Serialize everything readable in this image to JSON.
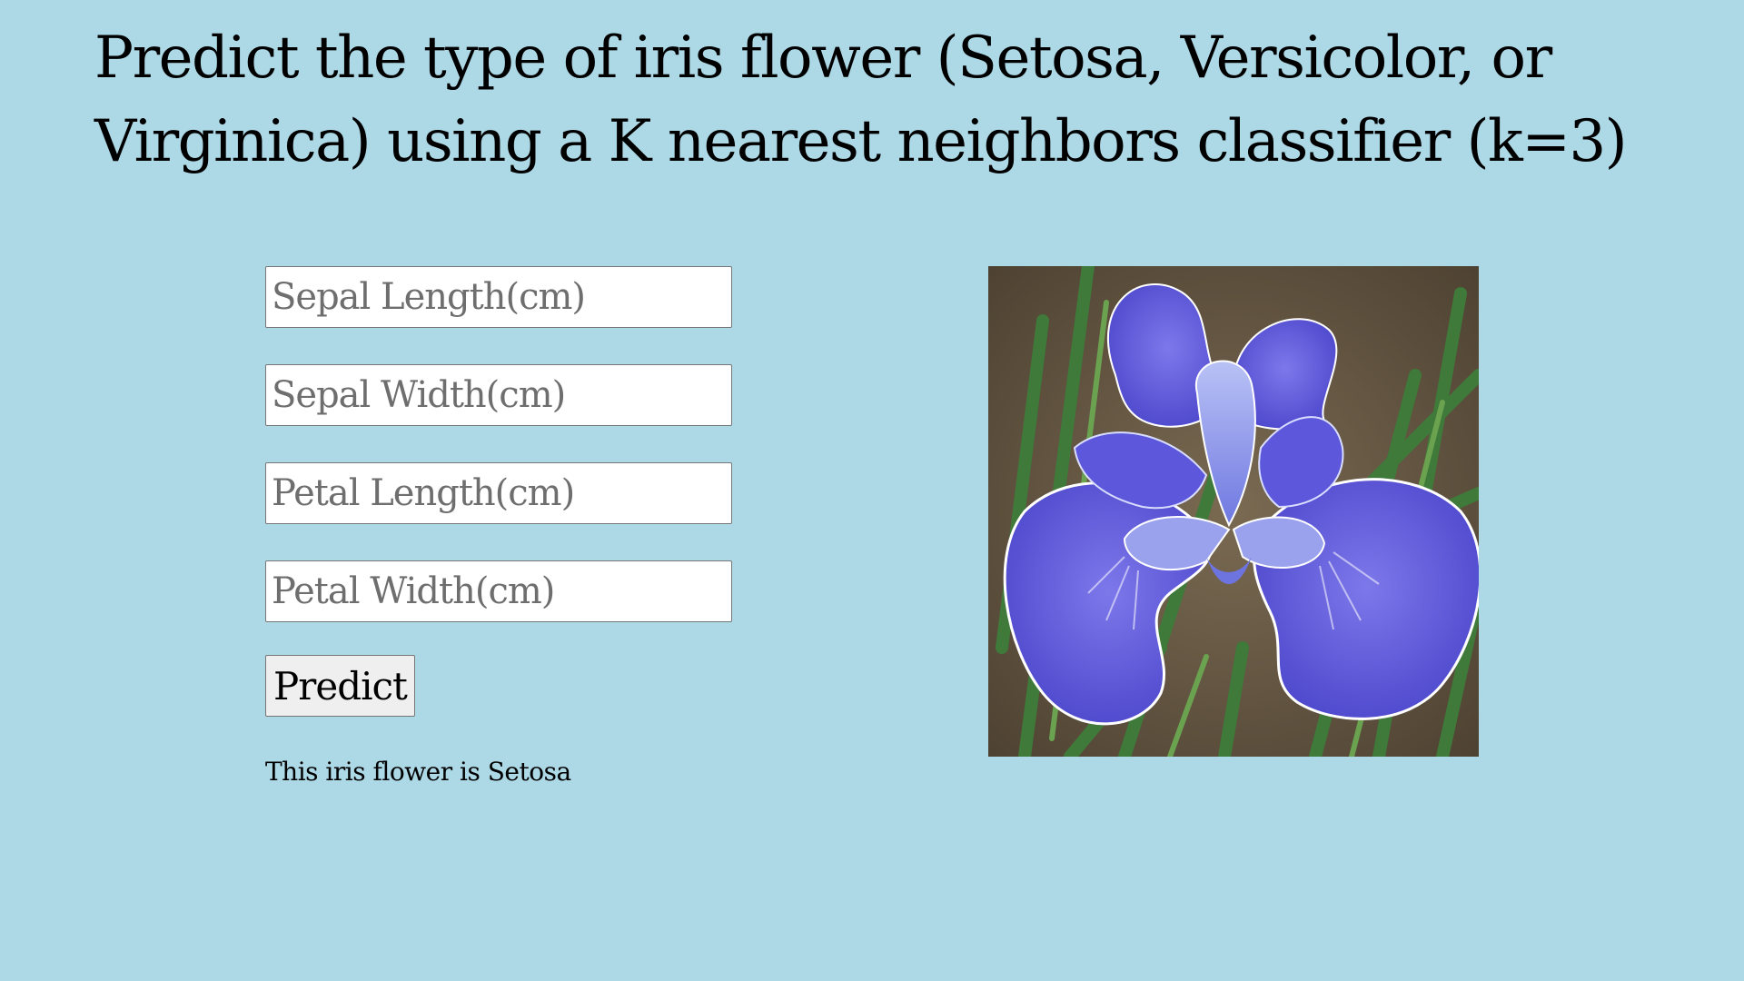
{
  "header": {
    "title": "Predict the type of iris flower (Setosa, Versicolor, or Virginica) using a K nearest neighbors classifier (k=3)"
  },
  "form": {
    "fields": [
      {
        "placeholder": "Sepal Length(cm)",
        "value": ""
      },
      {
        "placeholder": "Sepal Width(cm)",
        "value": ""
      },
      {
        "placeholder": "Petal Length(cm)",
        "value": ""
      },
      {
        "placeholder": "Petal Width(cm)",
        "value": ""
      }
    ],
    "submit_label": "Predict"
  },
  "result": {
    "text": "This iris flower is Setosa"
  },
  "image": {
    "subject": "iris-flower-photo",
    "colors": {
      "background": "#add8e6",
      "petal": "#5b55d6",
      "petal_light": "#8c8cec",
      "leaf": "#3f7a3a",
      "soil": "#6b5a45"
    }
  }
}
